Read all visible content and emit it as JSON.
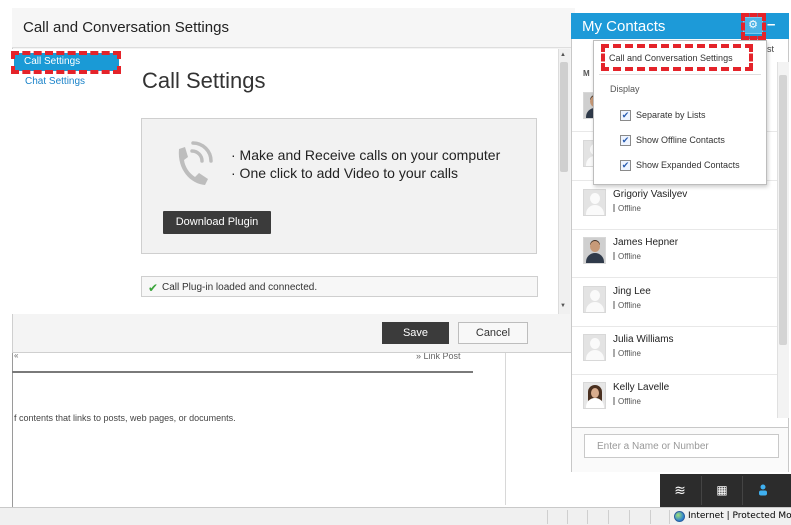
{
  "dialog": {
    "title": "Call and Conversation Settings",
    "nav": [
      "Call Settings",
      "Chat Settings"
    ],
    "content_title": "Call Settings",
    "features": [
      "· Make and Receive calls on your computer",
      "· One click to add Video to your calls"
    ],
    "download_label": "Download Plugin",
    "status_text": "Call Plug-in loaded and connected.",
    "save_label": "Save",
    "cancel_label": "Cancel"
  },
  "background": {
    "snippet_text": "f contents that links to posts, web pages, or documents.",
    "link_text": "» Link Post",
    "arrow_text": "«"
  },
  "contacts": {
    "title": "My Contacts",
    "gear_icon": "gear-icon",
    "minimize_symbol": "–",
    "search_placeholder": "Enter a Name or Number",
    "peek_last": "st",
    "peek_m": "M",
    "list": [
      {
        "name": "Grigoriy Vasilyev",
        "status": "Offline",
        "avatar": "placeholder"
      },
      {
        "name": "James Hepner",
        "status": "Offline",
        "avatar": "photo-m"
      },
      {
        "name": "Jing Lee",
        "status": "Offline",
        "avatar": "placeholder"
      },
      {
        "name": "Julia Williams",
        "status": "Offline",
        "avatar": "placeholder"
      },
      {
        "name": "Kelly Lavelle",
        "status": "Offline",
        "avatar": "photo-f"
      }
    ]
  },
  "menu": {
    "settings_item": "Call and Conversation Settings",
    "display_heading": "Display",
    "options": [
      {
        "label": "Separate by Lists",
        "checked": true
      },
      {
        "label": "Show Offline Contacts",
        "checked": true
      },
      {
        "label": "Show Expanded Contacts",
        "checked": true
      }
    ]
  },
  "footer": {
    "icons": [
      "activity-stream-icon",
      "calendar-icon",
      "contacts-person-icon"
    ]
  },
  "statusbar": {
    "zone": "Internet | Protected Mode"
  },
  "colors": {
    "accent": "#1d9ad8",
    "highlight": "#e4232a",
    "button_dark": "#3b3b3b",
    "success": "#3aa53a"
  }
}
